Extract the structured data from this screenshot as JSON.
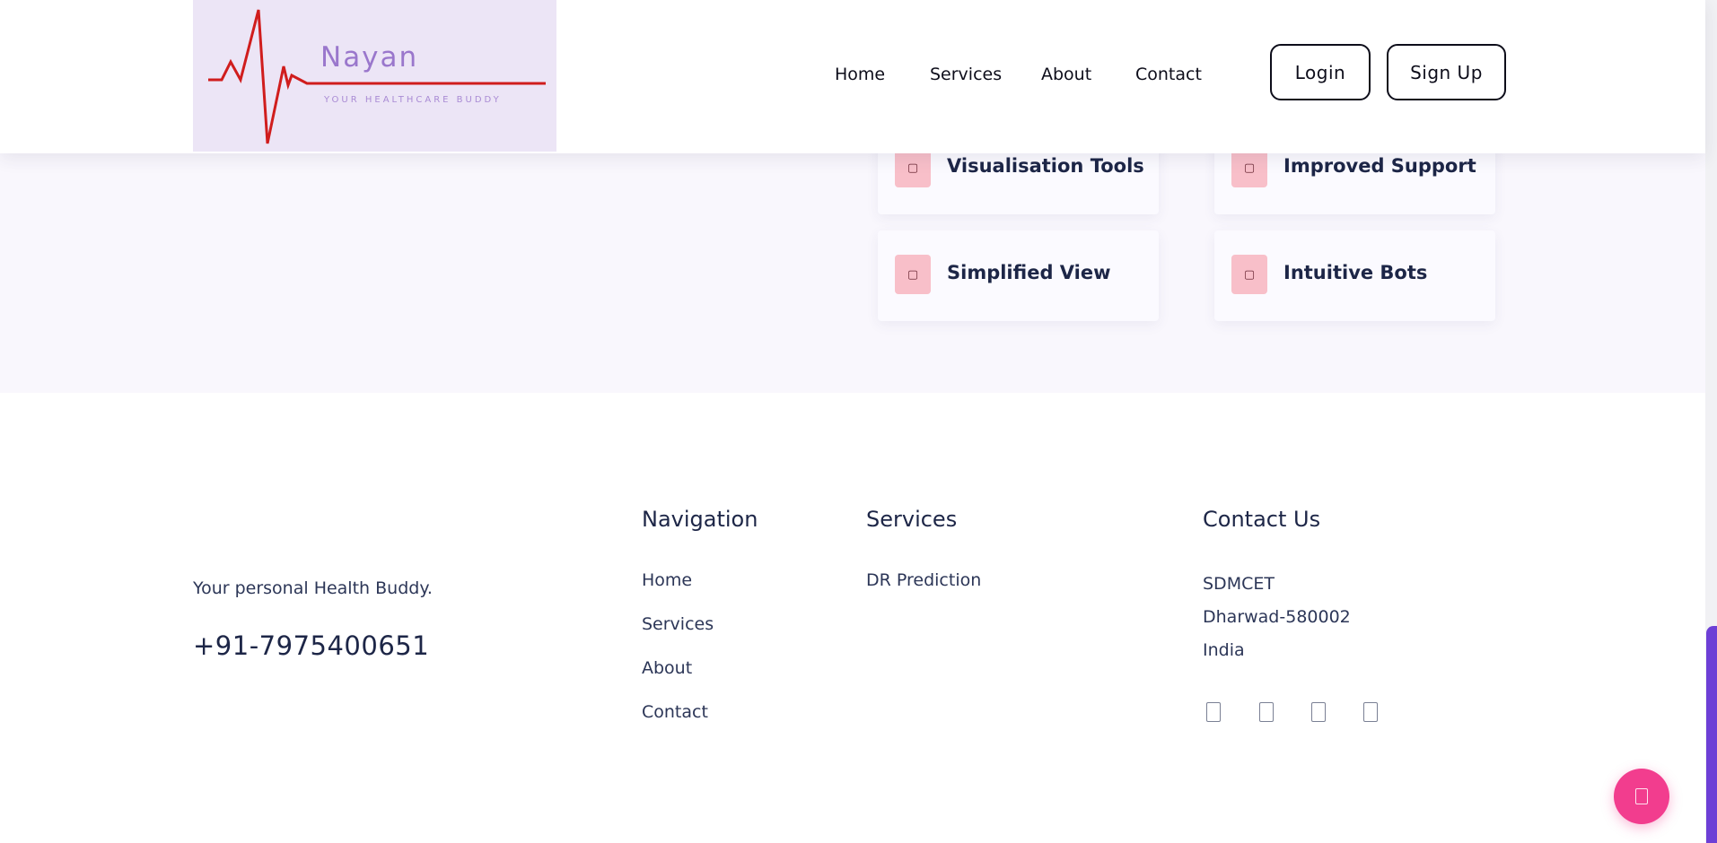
{
  "header": {
    "logo": {
      "name": "Nayan",
      "tagline": "YOUR HEALTHCARE BUDDY"
    },
    "nav": [
      "Home",
      "Services",
      "About",
      "Contact"
    ],
    "login_label": "Login",
    "signup_label": "Sign Up"
  },
  "features": [
    {
      "label": "Visualisation Tools",
      "icon": "feature-icon"
    },
    {
      "label": "Improved Support",
      "icon": "feature-icon"
    },
    {
      "label": "Simplified View",
      "icon": "feature-icon"
    },
    {
      "label": "Intuitive Bots",
      "icon": "feature-icon"
    }
  ],
  "footer": {
    "tagline": "Your personal Health Buddy.",
    "phone": "+91-7975400651",
    "navigation": {
      "heading": "Navigation",
      "links": [
        "Home",
        "Services",
        "About",
        "Contact"
      ]
    },
    "services": {
      "heading": "Services",
      "links": [
        "DR Prediction"
      ]
    },
    "contact": {
      "heading": "Contact Us",
      "lines": [
        "SDMCET",
        "Dharwad-580002",
        "India"
      ]
    },
    "social_icons": [
      "social-icon-1",
      "social-icon-2",
      "social-icon-3",
      "social-icon-4"
    ]
  },
  "fab": {
    "icon": "chat-icon"
  },
  "colors": {
    "accent": "#f23d8e",
    "feature_icon_bg": "#f8bfc9",
    "section_bg": "#f9f7fd",
    "logo_bg": "#ece5f6",
    "heartbeat": "#d01d1d",
    "scrollbar": "#6d3fd6",
    "text": "#1d2647"
  }
}
